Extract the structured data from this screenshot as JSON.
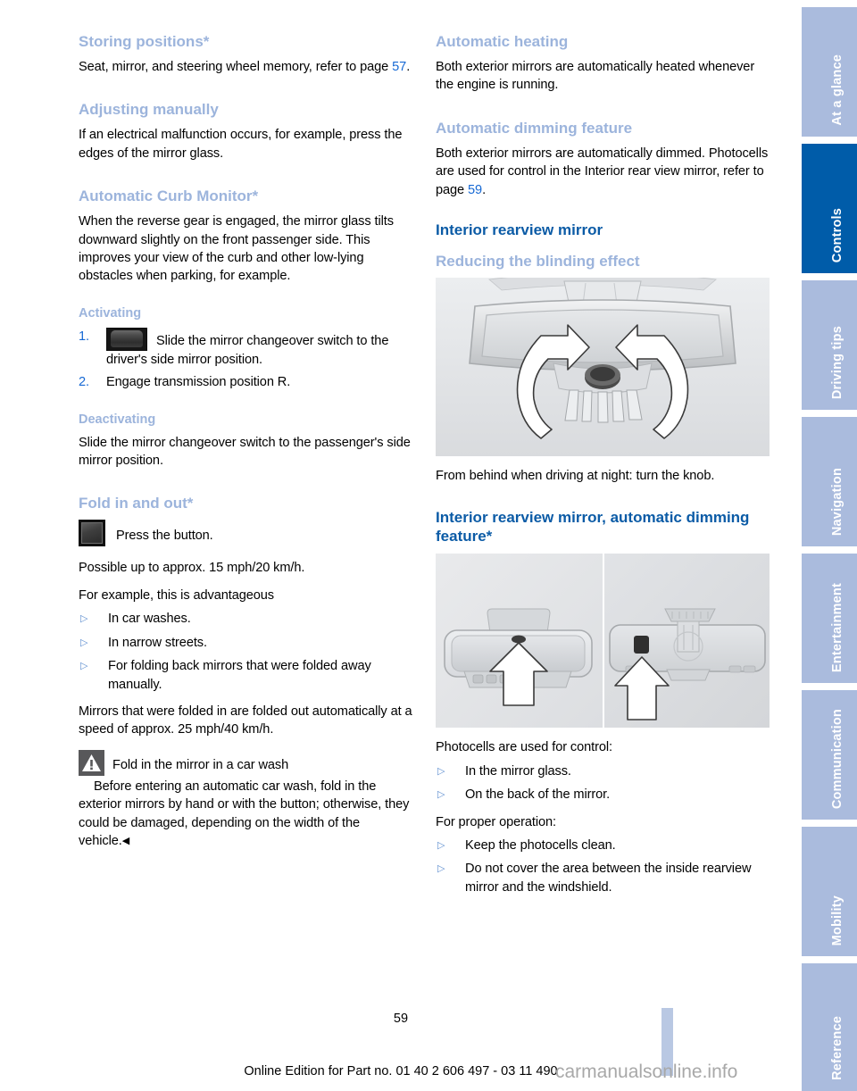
{
  "document": {
    "page_number": "59",
    "footer": "Online Edition for Part no. 01 40 2 606 497 - 03 11 490",
    "watermark": "carmanualsonline.info"
  },
  "sidebar": {
    "active_color": "#005ca9",
    "inactive_color": "#aabbdd",
    "tabs": [
      {
        "label": "At a glance",
        "active": false
      },
      {
        "label": "Controls",
        "active": true
      },
      {
        "label": "Driving tips",
        "active": false
      },
      {
        "label": "Navigation",
        "active": false
      },
      {
        "label": "Entertainment",
        "active": false
      },
      {
        "label": "Communication",
        "active": false
      },
      {
        "label": "Mobility",
        "active": false
      },
      {
        "label": "Reference",
        "active": false
      }
    ]
  },
  "colors": {
    "heading_light_blue": "#9cb4dc",
    "heading_dark_blue": "#0b5ba6",
    "link_blue": "#1769d4",
    "bullet_blue": "#5f8fd0"
  },
  "left_column": {
    "storing_positions": {
      "heading": "Storing positions*",
      "body_a": "Seat, mirror, and steering wheel memory, refer to page ",
      "page_ref": "57",
      "body_b": "."
    },
    "adjusting_manually": {
      "heading": "Adjusting manually",
      "body": "If an electrical malfunction occurs, for example, press the edges of the mirror glass."
    },
    "curb_monitor": {
      "heading": "Automatic Curb Monitor*",
      "body": "When the reverse gear is engaged, the mirror glass tilts downward slightly on the front passenger side. This improves your view of the curb and other low-lying obstacles when parking, for example."
    },
    "activating": {
      "heading": "Activating",
      "step_1_num": "1.",
      "step_1_icon": "rocker-switch-icon",
      "step_1_text": "Slide the mirror changeover switch to the driver's side mirror position.",
      "step_2_num": "2.",
      "step_2_text": "Engage transmission position R."
    },
    "deactivating": {
      "heading": "Deactivating",
      "body": "Slide the mirror changeover switch to the passenger's side mirror position."
    },
    "fold_in_out": {
      "heading": "Fold in and out*",
      "button_icon": "fold-mirror-button-icon",
      "button_text": "Press the button.",
      "body_1": "Possible up to approx. 15 mph/20 km/h.",
      "body_2": "For example, this is advantageous",
      "bullets": [
        "In car washes.",
        "In narrow streets.",
        "For folding back mirrors that were folded away manually."
      ],
      "body_3": "Mirrors that were folded in are folded out automatically at a speed of approx. 25 mph/40 km/h."
    },
    "warning": {
      "icon": "warning-triangle-icon",
      "title": "Fold in the mirror in a car wash",
      "body": "Before entering an automatic car wash, fold in the exterior mirrors by hand or with the button; otherwise, they could be damaged, depending on the width of the vehicle.",
      "end_mark": "◀"
    }
  },
  "right_column": {
    "automatic_heating": {
      "heading": "Automatic heating",
      "body": "Both exterior mirrors are automatically heated whenever the engine is running."
    },
    "automatic_dimming": {
      "heading": "Automatic dimming feature",
      "body_a": "Both exterior mirrors are automatically dimmed. Photocells are used for control in the Interior rear view mirror, refer to page ",
      "page_ref": "59",
      "body_b": "."
    },
    "interior_rearview_mirror": {
      "heading": "Interior rearview mirror",
      "sub_heading": "Reducing the blinding effect",
      "figure_name": "rearview-mirror-knob-figure",
      "caption": "From behind when driving at night: turn the knob."
    },
    "auto_dimming_mirror": {
      "heading": "Interior rearview mirror, automatic dimming feature*",
      "figure_name": "photocell-locations-figure",
      "intro_1": "Photocells are used for control:",
      "bullets_1": [
        "In the mirror glass.",
        "On the back of the mirror."
      ],
      "intro_2": "For proper operation:",
      "bullets_2": [
        "Keep the photocells clean.",
        "Do not cover the area between the inside rearview mirror and the windshield."
      ]
    }
  }
}
